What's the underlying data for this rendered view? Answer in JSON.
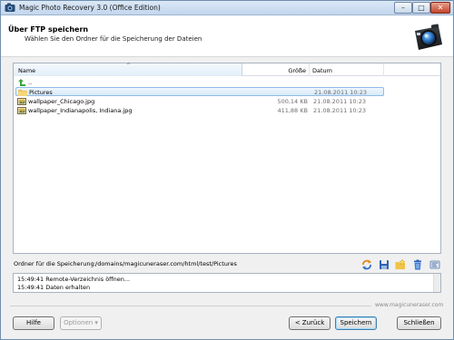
{
  "window": {
    "title": "Magic Photo Recovery 3.0 (Office Edition)",
    "controls": {
      "minimize": "–",
      "maximize": "□",
      "close": "✕"
    }
  },
  "header": {
    "title": "Über FTP speichern",
    "subtitle": "Wählen Sie den Ordner für die Speicherung der Dateien"
  },
  "filelist": {
    "columns": {
      "name": "Name",
      "size": "Größe",
      "date": "Datum"
    },
    "sort_indicator": "^",
    "rows": [
      {
        "name": "..",
        "size": "",
        "date": "",
        "icon": "up-arrow-icon"
      },
      {
        "name": "Pictures",
        "size": "",
        "date": "21.08.2011 10:23",
        "icon": "folder-icon",
        "selected": true
      },
      {
        "name": "wallpaper_Chicago.jpg",
        "size": "500,14 KB",
        "date": "21.08.2011 10:23",
        "icon": "image-file-icon"
      },
      {
        "name": "wallpaper_Indianapolis, Indiana.jpg",
        "size": "411,88 KB",
        "date": "21.08.2011 10:23",
        "icon": "image-file-icon"
      }
    ]
  },
  "path": {
    "label": "Ordner für die Speicherung:",
    "value": "/domains/magicuneraser.com/html/test/Pictures"
  },
  "toolbar": {
    "icons": [
      "refresh-icon",
      "save-icon",
      "new-folder-icon",
      "delete-icon",
      "properties-icon"
    ]
  },
  "log": {
    "lines": [
      "15:49:41 Remote-Verzeichnis öffnen...",
      "15:49:41 Daten erhalten"
    ]
  },
  "watermark": "www.magicuneraser.com",
  "buttons": {
    "help": "Hilfe",
    "options": "Optionen ▾",
    "back": "< Zurück",
    "save": "Speichern",
    "close": "Schließen"
  },
  "colors": {
    "selection": "#d7eaf9",
    "accent": "#3c7fb1"
  }
}
